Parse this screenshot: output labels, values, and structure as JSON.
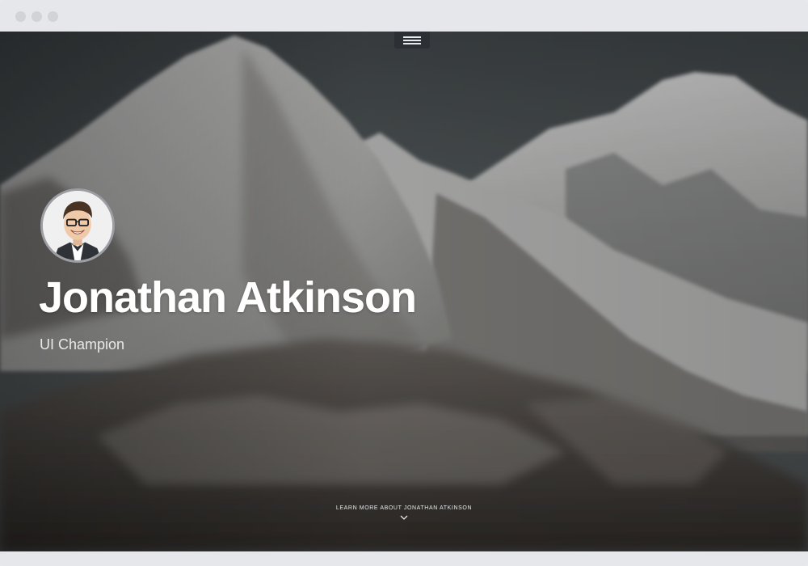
{
  "profile": {
    "name": "Jonathan Atkinson",
    "role": "UI Champion"
  },
  "learn_more": {
    "label": "LEARN MORE ABOUT JONATHAN ATKINSON"
  },
  "icons": {
    "menu": "hamburger-menu-icon",
    "scroll_down": "chevron-down-icon"
  },
  "colors": {
    "menu_button_bg": "#2b3034",
    "hero_text": "#ffffff",
    "window_chrome": "#e6e7ea"
  }
}
